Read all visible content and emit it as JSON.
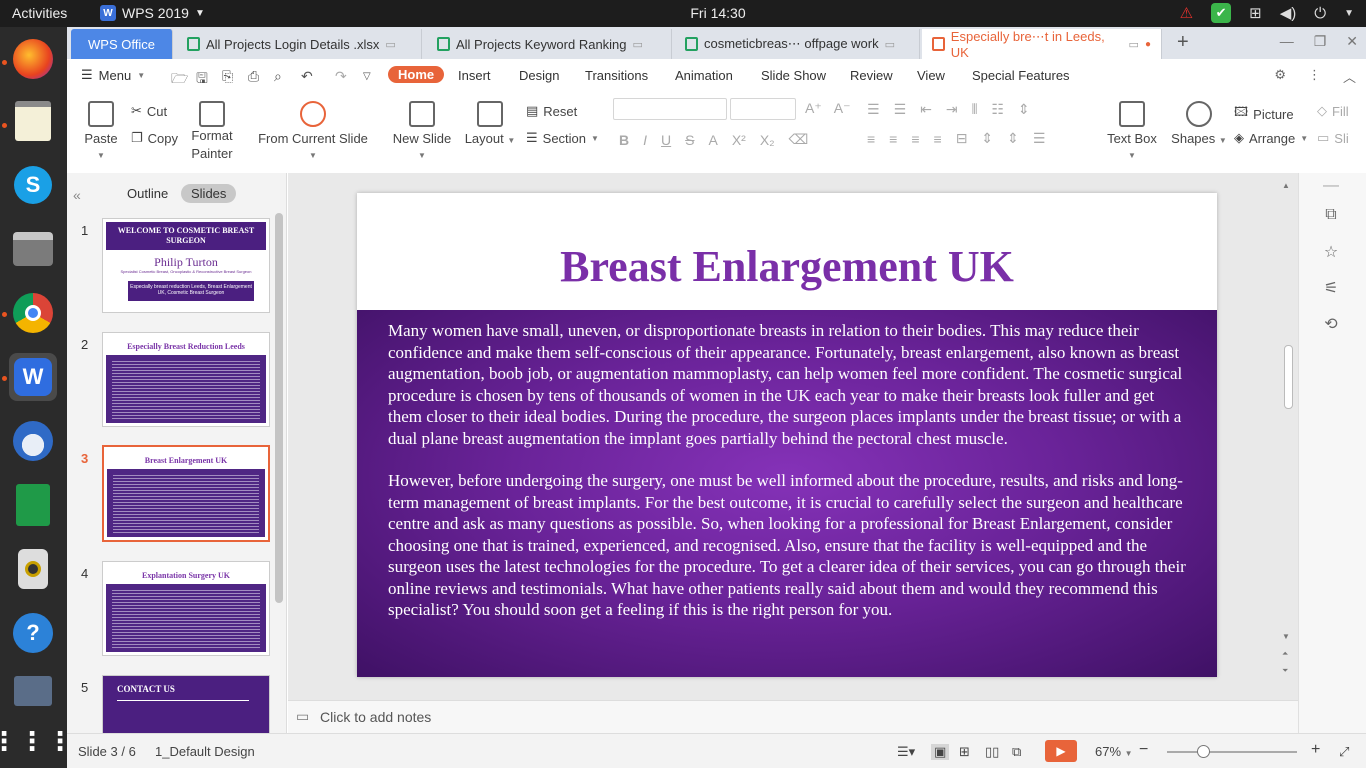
{
  "system": {
    "activities": "Activities",
    "app_name": "WPS 2019",
    "clock": "Fri 14:30"
  },
  "tabs": [
    {
      "label": "WPS Office"
    },
    {
      "label": "All Projects Login Details .xlsx"
    },
    {
      "label": "All Projects Keyword Ranking"
    },
    {
      "label": "cosmeticbreas⋯ offpage work"
    },
    {
      "label": "Especially bre⋯t in Leeds, UK"
    }
  ],
  "menubar": {
    "menu": "Menu",
    "tabs": [
      "Home",
      "Insert",
      "Design",
      "Transitions",
      "Animation",
      "Slide Show",
      "Review",
      "View",
      "Special Features"
    ]
  },
  "ribbon": {
    "paste": "Paste",
    "cut": "Cut",
    "copy": "Copy",
    "format_painter_1": "Format",
    "format_painter_2": "Painter",
    "from_current": "From Current Slide",
    "new_slide": "New Slide",
    "layout": "Layout",
    "reset": "Reset",
    "section": "Section",
    "text_box": "Text Box",
    "shapes": "Shapes",
    "picture": "Picture",
    "arrange": "Arrange",
    "fill": "Fill",
    "slide_trunc": "Sli"
  },
  "left_panel": {
    "outline": "Outline",
    "slides": "Slides",
    "thumbs": [
      {
        "num": "1",
        "title": "WELCOME TO COSMETIC BREAST SURGEON",
        "logo": "Philip Turton",
        "sub": "Specialist Cosmetic Breast, Oncoplastic & Reconstructive Breast Surgeon",
        "box": "Especially breast reduction Leeds, Breast Enlargement UK, Cosmetic Breast Surgeon"
      },
      {
        "num": "2",
        "title": "Especially Breast Reduction Leeds"
      },
      {
        "num": "3",
        "title": "Breast Enlargement UK"
      },
      {
        "num": "4",
        "title": "Explantation Surgery UK"
      },
      {
        "num": "5",
        "title": "CONTACT US"
      }
    ]
  },
  "slide": {
    "title": "Breast Enlargement UK",
    "para1": "Many women have small, uneven, or disproportionate breasts in relation to their bodies. This may reduce their confidence and make them self-conscious of their appearance. Fortunately, breast enlargement, also known as breast augmentation, boob job, or augmentation mammoplasty, can help women feel more confident. The cosmetic surgical procedure is chosen by tens of thousands of women in the UK each year to make their breasts look fuller and get them closer to their ideal bodies. During the procedure, the surgeon places implants under the breast tissue; or with a dual plane breast augmentation the implant goes partially behind the pectoral chest muscle.",
    "para2": "However, before undergoing the surgery, one must be well informed about the procedure, results, and risks and long-term management of breast implants. For the best outcome, it is crucial to carefully select the surgeon and healthcare centre and ask as many questions as possible. So, when looking for a professional for Breast Enlargement, consider choosing one that is trained, experienced, and recognised. Also, ensure that the facility is well-equipped and the surgeon uses the latest technologies for the procedure. To get a clearer idea of their services, you can go through their online reviews and testimonials. What have other patients really said about them and would they recommend this specialist? You should soon get a feeling if this is the right person for you."
  },
  "notes": {
    "placeholder": "Click to add notes"
  },
  "status": {
    "slide_info": "Slide 3 / 6",
    "design": "1_Default Design",
    "zoom": "67%",
    "zoom_level": 0.28
  },
  "colors": {
    "accent": "#e8643a",
    "slide_title": "#7a2fa8",
    "slide_body": "#6a2399"
  }
}
